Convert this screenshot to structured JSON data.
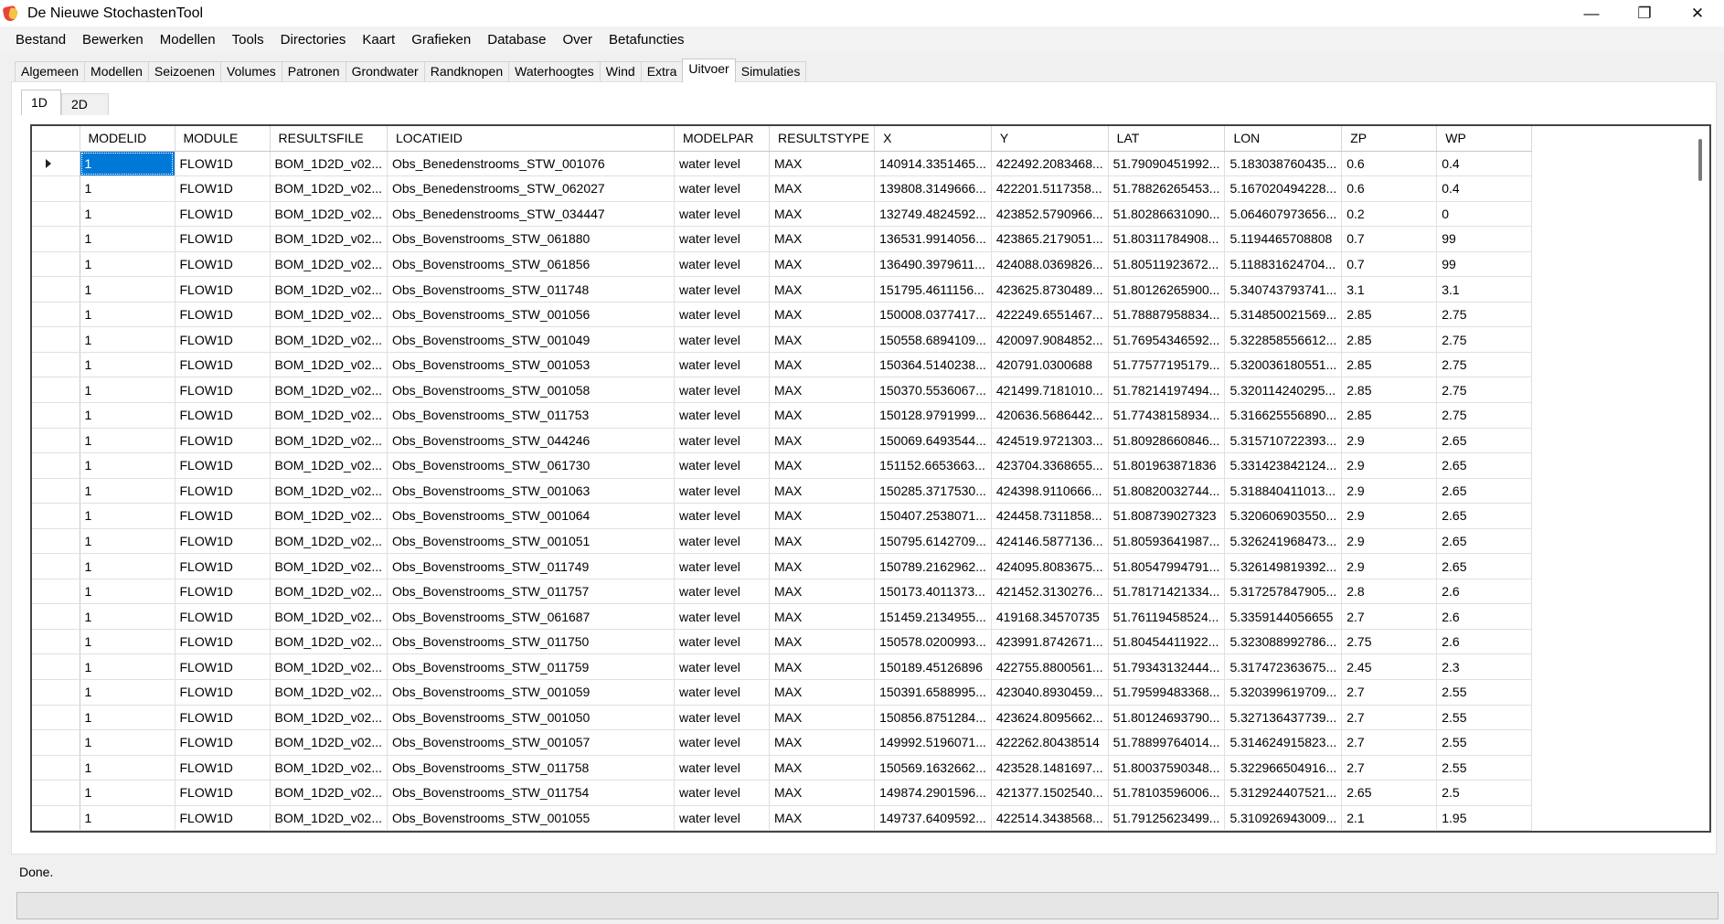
{
  "app": {
    "title": "De Nieuwe StochastenTool",
    "icon": "app-logo-icon"
  },
  "window_controls": [
    {
      "name": "minimize-button",
      "glyph": "—"
    },
    {
      "name": "restore-button",
      "glyph": "❐"
    },
    {
      "name": "close-button",
      "glyph": "✕"
    }
  ],
  "menu": [
    "Bestand",
    "Bewerken",
    "Modellen",
    "Tools",
    "Directories",
    "Kaart",
    "Grafieken",
    "Database",
    "Over",
    "Betafuncties"
  ],
  "tabs": [
    {
      "label": "Algemeen",
      "active": false
    },
    {
      "label": "Modellen",
      "active": false
    },
    {
      "label": "Seizoenen",
      "active": false
    },
    {
      "label": "Volumes",
      "active": false
    },
    {
      "label": "Patronen",
      "active": false
    },
    {
      "label": "Grondwater",
      "active": false
    },
    {
      "label": "Randknopen",
      "active": false
    },
    {
      "label": "Waterhoogtes",
      "active": false
    },
    {
      "label": "Wind",
      "active": false
    },
    {
      "label": "Extra",
      "active": false
    },
    {
      "label": "Uitvoer",
      "active": true
    },
    {
      "label": "Simulaties",
      "active": false
    }
  ],
  "subtabs": [
    {
      "label": "1D",
      "active": true
    },
    {
      "label": "2D",
      "active": false
    }
  ],
  "grid": {
    "columns": [
      "MODELID",
      "MODULE",
      "RESULTSFILE",
      "LOCATIEID",
      "MODELPAR",
      "RESULTSTYPE",
      "X",
      "Y",
      "LAT",
      "LON",
      "ZP",
      "WP"
    ],
    "selected": {
      "row": 0,
      "col": 0
    },
    "rows": [
      [
        "1",
        "FLOW1D",
        "BOM_1D2D_v02...",
        "Obs_Benedenstrooms_STW_001076",
        "water level",
        "MAX",
        "140914.3351465...",
        "422492.2083468...",
        "51.79090451992...",
        "5.183038760435...",
        "0.6",
        "0.4"
      ],
      [
        "1",
        "FLOW1D",
        "BOM_1D2D_v02...",
        "Obs_Benedenstrooms_STW_062027",
        "water level",
        "MAX",
        "139808.3149666...",
        "422201.5117358...",
        "51.78826265453...",
        "5.167020494228...",
        "0.6",
        "0.4"
      ],
      [
        "1",
        "FLOW1D",
        "BOM_1D2D_v02...",
        "Obs_Benedenstrooms_STW_034447",
        "water level",
        "MAX",
        "132749.4824592...",
        "423852.5790966...",
        "51.80286631090...",
        "5.064607973656...",
        "0.2",
        "0"
      ],
      [
        "1",
        "FLOW1D",
        "BOM_1D2D_v02...",
        "Obs_Bovenstrooms_STW_061880",
        "water level",
        "MAX",
        "136531.9914056...",
        "423865.2179051...",
        "51.80311784908...",
        "5.1194465708808",
        "0.7",
        "99"
      ],
      [
        "1",
        "FLOW1D",
        "BOM_1D2D_v02...",
        "Obs_Bovenstrooms_STW_061856",
        "water level",
        "MAX",
        "136490.3979611...",
        "424088.0369826...",
        "51.80511923672...",
        "5.118831624704...",
        "0.7",
        "99"
      ],
      [
        "1",
        "FLOW1D",
        "BOM_1D2D_v02...",
        "Obs_Bovenstrooms_STW_011748",
        "water level",
        "MAX",
        "151795.4611156...",
        "423625.8730489...",
        "51.80126265900...",
        "5.340743793741...",
        "3.1",
        "3.1"
      ],
      [
        "1",
        "FLOW1D",
        "BOM_1D2D_v02...",
        "Obs_Bovenstrooms_STW_001056",
        "water level",
        "MAX",
        "150008.0377417...",
        "422249.6551467...",
        "51.78887958834...",
        "5.314850021569...",
        "2.85",
        "2.75"
      ],
      [
        "1",
        "FLOW1D",
        "BOM_1D2D_v02...",
        "Obs_Bovenstrooms_STW_001049",
        "water level",
        "MAX",
        "150558.6894109...",
        "420097.9084852...",
        "51.76954346592...",
        "5.322858556612...",
        "2.85",
        "2.75"
      ],
      [
        "1",
        "FLOW1D",
        "BOM_1D2D_v02...",
        "Obs_Bovenstrooms_STW_001053",
        "water level",
        "MAX",
        "150364.5140238...",
        "420791.0300688",
        "51.77577195179...",
        "5.320036180551...",
        "2.85",
        "2.75"
      ],
      [
        "1",
        "FLOW1D",
        "BOM_1D2D_v02...",
        "Obs_Bovenstrooms_STW_001058",
        "water level",
        "MAX",
        "150370.5536067...",
        "421499.7181010...",
        "51.78214197494...",
        "5.320114240295...",
        "2.85",
        "2.75"
      ],
      [
        "1",
        "FLOW1D",
        "BOM_1D2D_v02...",
        "Obs_Bovenstrooms_STW_011753",
        "water level",
        "MAX",
        "150128.9791999...",
        "420636.5686442...",
        "51.77438158934...",
        "5.316625556890...",
        "2.85",
        "2.75"
      ],
      [
        "1",
        "FLOW1D",
        "BOM_1D2D_v02...",
        "Obs_Bovenstrooms_STW_044246",
        "water level",
        "MAX",
        "150069.6493544...",
        "424519.9721303...",
        "51.80928660846...",
        "5.315710722393...",
        "2.9",
        "2.65"
      ],
      [
        "1",
        "FLOW1D",
        "BOM_1D2D_v02...",
        "Obs_Bovenstrooms_STW_061730",
        "water level",
        "MAX",
        "151152.6653663...",
        "423704.3368655...",
        "51.801963871836",
        "5.331423842124...",
        "2.9",
        "2.65"
      ],
      [
        "1",
        "FLOW1D",
        "BOM_1D2D_v02...",
        "Obs_Bovenstrooms_STW_001063",
        "water level",
        "MAX",
        "150285.3717530...",
        "424398.9110666...",
        "51.80820032744...",
        "5.318840411013...",
        "2.9",
        "2.65"
      ],
      [
        "1",
        "FLOW1D",
        "BOM_1D2D_v02...",
        "Obs_Bovenstrooms_STW_001064",
        "water level",
        "MAX",
        "150407.2538071...",
        "424458.7311858...",
        "51.808739027323",
        "5.320606903550...",
        "2.9",
        "2.65"
      ],
      [
        "1",
        "FLOW1D",
        "BOM_1D2D_v02...",
        "Obs_Bovenstrooms_STW_001051",
        "water level",
        "MAX",
        "150795.6142709...",
        "424146.5877136...",
        "51.80593641987...",
        "5.326241968473...",
        "2.9",
        "2.65"
      ],
      [
        "1",
        "FLOW1D",
        "BOM_1D2D_v02...",
        "Obs_Bovenstrooms_STW_011749",
        "water level",
        "MAX",
        "150789.2162962...",
        "424095.8083675...",
        "51.80547994791...",
        "5.326149819392...",
        "2.9",
        "2.65"
      ],
      [
        "1",
        "FLOW1D",
        "BOM_1D2D_v02...",
        "Obs_Bovenstrooms_STW_011757",
        "water level",
        "MAX",
        "150173.4011373...",
        "421452.3130276...",
        "51.78171421334...",
        "5.317257847905...",
        "2.8",
        "2.6"
      ],
      [
        "1",
        "FLOW1D",
        "BOM_1D2D_v02...",
        "Obs_Bovenstrooms_STW_061687",
        "water level",
        "MAX",
        "151459.2134955...",
        "419168.34570735",
        "51.76119458524...",
        "5.3359144056655",
        "2.7",
        "2.6"
      ],
      [
        "1",
        "FLOW1D",
        "BOM_1D2D_v02...",
        "Obs_Bovenstrooms_STW_011750",
        "water level",
        "MAX",
        "150578.0200993...",
        "423991.8742671...",
        "51.80454411922...",
        "5.323088992786...",
        "2.75",
        "2.6"
      ],
      [
        "1",
        "FLOW1D",
        "BOM_1D2D_v02...",
        "Obs_Bovenstrooms_STW_011759",
        "water level",
        "MAX",
        "150189.45126896",
        "422755.8800561...",
        "51.79343132444...",
        "5.317472363675...",
        "2.45",
        "2.3"
      ],
      [
        "1",
        "FLOW1D",
        "BOM_1D2D_v02...",
        "Obs_Bovenstrooms_STW_001059",
        "water level",
        "MAX",
        "150391.6588995...",
        "423040.8930459...",
        "51.79599483368...",
        "5.320399619709...",
        "2.7",
        "2.55"
      ],
      [
        "1",
        "FLOW1D",
        "BOM_1D2D_v02...",
        "Obs_Bovenstrooms_STW_001050",
        "water level",
        "MAX",
        "150856.8751284...",
        "423624.8095662...",
        "51.80124693790...",
        "5.327136437739...",
        "2.7",
        "2.55"
      ],
      [
        "1",
        "FLOW1D",
        "BOM_1D2D_v02...",
        "Obs_Bovenstrooms_STW_001057",
        "water level",
        "MAX",
        "149992.5196071...",
        "422262.80438514",
        "51.78899764014...",
        "5.314624915823...",
        "2.7",
        "2.55"
      ],
      [
        "1",
        "FLOW1D",
        "BOM_1D2D_v02...",
        "Obs_Bovenstrooms_STW_011758",
        "water level",
        "MAX",
        "150569.1632662...",
        "423528.1481697...",
        "51.80037590348...",
        "5.322966504916...",
        "2.7",
        "2.55"
      ],
      [
        "1",
        "FLOW1D",
        "BOM_1D2D_v02...",
        "Obs_Bovenstrooms_STW_011754",
        "water level",
        "MAX",
        "149874.2901596...",
        "421377.1502540...",
        "51.78103596006...",
        "5.312924407521...",
        "2.65",
        "2.5"
      ],
      [
        "1",
        "FLOW1D",
        "BOM_1D2D_v02...",
        "Obs_Bovenstrooms_STW_001055",
        "water level",
        "MAX",
        "149737.6409592...",
        "422514.3438568...",
        "51.79125623499...",
        "5.310926943009...",
        "2.1",
        "1.95"
      ]
    ]
  },
  "status": {
    "text": "Done.",
    "progress": 0
  },
  "colors": {
    "selection": "#0078d7",
    "progress_fill": "#06b025"
  }
}
